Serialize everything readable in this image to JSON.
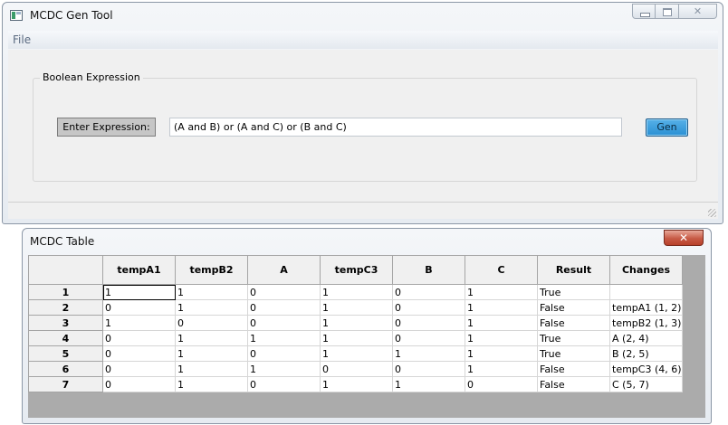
{
  "main_window": {
    "title": "MCDC Gen Tool",
    "menu": {
      "file": "File"
    },
    "group": {
      "legend": "Boolean Expression",
      "label": "Enter Expression:",
      "expression_value": "(A and B) or (A and C) or (B and C)",
      "gen_button": "Gen"
    },
    "caption_buttons": {
      "minimize": "minimize-icon",
      "maximize": "maximize-icon",
      "close": "✕"
    }
  },
  "table_window": {
    "title": "MCDC Table",
    "close_glyph": "✕",
    "columns": [
      "tempA1",
      "tempB2",
      "A",
      "tempC3",
      "B",
      "C",
      "Result",
      "Changes"
    ],
    "rows": [
      {
        "num": "1",
        "cells": [
          "1",
          "1",
          "0",
          "1",
          "0",
          "1",
          "True",
          ""
        ]
      },
      {
        "num": "2",
        "cells": [
          "0",
          "1",
          "0",
          "1",
          "0",
          "1",
          "False",
          "tempA1 (1, 2)"
        ]
      },
      {
        "num": "3",
        "cells": [
          "1",
          "0",
          "0",
          "1",
          "0",
          "1",
          "False",
          "tempB2 (1, 3)"
        ]
      },
      {
        "num": "4",
        "cells": [
          "0",
          "1",
          "1",
          "1",
          "0",
          "1",
          "True",
          "A (2, 4)"
        ]
      },
      {
        "num": "5",
        "cells": [
          "0",
          "1",
          "0",
          "1",
          "1",
          "1",
          "True",
          "B (2, 5)"
        ]
      },
      {
        "num": "6",
        "cells": [
          "0",
          "1",
          "1",
          "0",
          "0",
          "1",
          "False",
          "tempC3 (4, 6)"
        ]
      },
      {
        "num": "7",
        "cells": [
          "0",
          "1",
          "0",
          "1",
          "1",
          "0",
          "False",
          "C (5, 7)"
        ]
      }
    ]
  }
}
